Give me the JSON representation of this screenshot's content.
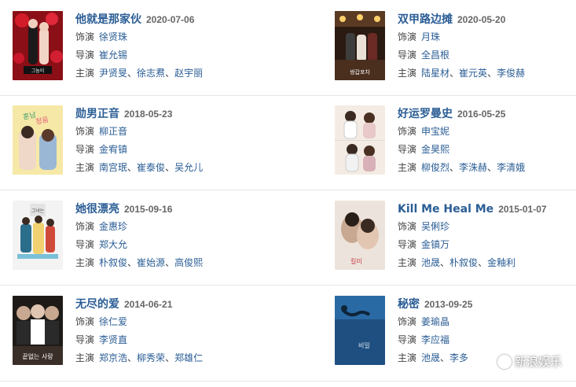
{
  "labels": {
    "role": "饰演",
    "director": "导演",
    "cast": "主演"
  },
  "dramas": [
    {
      "title": "他就是那家伙",
      "date": "2020-07-06",
      "role": "徐贤珠",
      "director": "崔允锡",
      "cast": [
        "尹贤旻",
        "徐志焄",
        "赵宇丽"
      ],
      "poster_icon": "poster-him-is-that-guy"
    },
    {
      "title": "双甲路边摊",
      "date": "2020-05-20",
      "role": "月珠",
      "director": "全昌根",
      "cast": [
        "陆星材",
        "崔元英",
        "李俊赫"
      ],
      "poster_icon": "poster-mystic-pop-up-bar"
    },
    {
      "title": "勋男正音",
      "date": "2018-05-23",
      "role": "柳正音",
      "director": "金宥镇",
      "cast": [
        "南宫珉",
        "崔泰俊",
        "吴允儿"
      ],
      "poster_icon": "poster-hoon-nam-jung-eum"
    },
    {
      "title": "好运罗曼史",
      "date": "2016-05-25",
      "role": "申宝妮",
      "director": "金昊熙",
      "cast": [
        "柳俊烈",
        "李洙赫",
        "李清娥"
      ],
      "poster_icon": "poster-lucky-romance"
    },
    {
      "title": "她很漂亮",
      "date": "2015-09-16",
      "role": "金惠珍",
      "director": "郑大允",
      "cast": [
        "朴叙俊",
        "崔始源",
        "高俊熙"
      ],
      "poster_icon": "poster-she-was-pretty"
    },
    {
      "title": "Kill Me Heal Me",
      "date": "2015-01-07",
      "role": "吴俐珍",
      "director": "金镇万",
      "cast": [
        "池晟",
        "朴叙俊",
        "金釉利"
      ],
      "poster_icon": "poster-kill-me-heal-me"
    },
    {
      "title": "无尽的爱",
      "date": "2014-06-21",
      "role": "徐仁爱",
      "director": "李贤直",
      "cast": [
        "郑京浩",
        "柳秀荣",
        "郑雄仁"
      ],
      "poster_icon": "poster-endless-love"
    },
    {
      "title": "秘密",
      "date": "2013-09-25",
      "role": "姜瑜晶",
      "director": "李应福",
      "cast": [
        "池晟",
        "李多",
        ""
      ],
      "poster_icon": "poster-secret-love"
    }
  ],
  "watermark": "新浪娱乐"
}
